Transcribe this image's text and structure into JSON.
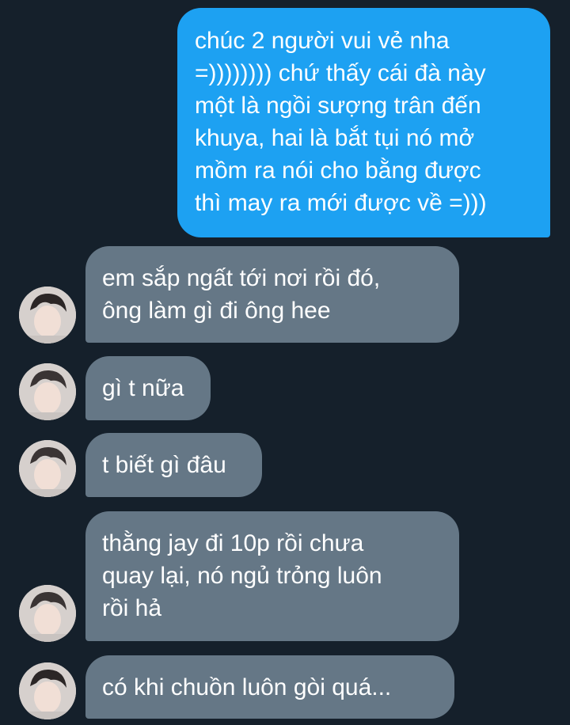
{
  "messages": [
    {
      "sender": "me",
      "text": "chúc 2 người vui vẻ nha\n=)))))))) chứ thấy cái đà này\nmột là ngồi sượng trân đến\nkhuya, hai là bắt tụi nó mở\nmồm ra nói cho bằng được\nthì may ra mới được về =)))"
    },
    {
      "sender": "other",
      "text": "em sắp ngất tới nơi rồi đó,\nông làm gì đi ông hee",
      "avatar_icon": "user-avatar-icon"
    },
    {
      "sender": "other",
      "text": "gì t nữa",
      "avatar_icon": "user-avatar-icon"
    },
    {
      "sender": "other",
      "text": "t biết gì đâu",
      "avatar_icon": "user-avatar-icon"
    },
    {
      "sender": "other",
      "text": "thằng jay đi 10p rồi chưa\nquay lại, nó ngủ trỏng luôn\nrồi hả",
      "avatar_icon": "user-avatar-icon"
    },
    {
      "sender": "other",
      "text": "có khi chuồn luôn gòi quá...",
      "avatar_icon": "user-avatar-icon"
    }
  ],
  "colors": {
    "background": "#15202b",
    "sent_bubble": "#1da1f2",
    "received_bubble": "#657786",
    "text": "#ffffff"
  }
}
